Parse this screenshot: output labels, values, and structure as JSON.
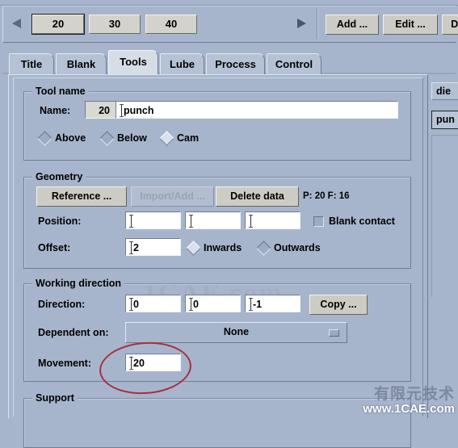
{
  "window": {
    "background_color": "#a7b5cc"
  },
  "toolbar": {
    "prev_arrow_icon": "triangle-left-icon",
    "next_arrow_icon": "triangle-right-icon",
    "pages": [
      {
        "label": "20",
        "selected": true
      },
      {
        "label": "30",
        "selected": false
      },
      {
        "label": "40",
        "selected": false
      }
    ],
    "commands": [
      {
        "label": "Add ..."
      },
      {
        "label": "Edit ..."
      },
      {
        "label": "Del"
      }
    ]
  },
  "tabs": [
    {
      "label": "Title",
      "active": false
    },
    {
      "label": "Blank",
      "active": false
    },
    {
      "label": "Tools",
      "active": true
    },
    {
      "label": "Lube",
      "active": false
    },
    {
      "label": "Process",
      "active": false
    },
    {
      "label": "Control",
      "active": false
    }
  ],
  "tool_name": {
    "group_title": "Tool name",
    "name_label": "Name:",
    "name_prefix": "20",
    "name_value": "punch",
    "placement_options": [
      {
        "label": "Above",
        "selected": false
      },
      {
        "label": "Below",
        "selected": false
      },
      {
        "label": "Cam",
        "selected": true
      }
    ]
  },
  "geometry": {
    "group_title": "Geometry",
    "reference_button": "Reference ...",
    "import_add_button": "Import/Add ...",
    "delete_data_button": "Delete data",
    "counter": "P: 20  F: 16",
    "position_label": "Position:",
    "position_values": [
      "",
      "",
      ""
    ],
    "blank_contact_label": "Blank contact",
    "blank_contact_checked": false,
    "offset_label": "Offset:",
    "offset_value": "2",
    "direction_options": [
      {
        "label": "Inwards",
        "selected": true
      },
      {
        "label": "Outwards",
        "selected": false
      }
    ]
  },
  "working_direction": {
    "group_title": "Working direction",
    "direction_label": "Direction:",
    "direction_values": [
      "0",
      "0",
      "-1"
    ],
    "copy_button": "Copy ...",
    "dependent_label": "Dependent on:",
    "dependent_value": "None",
    "dependent_arrow_icon": "dropdown-arrow-icon",
    "movement_label": "Movement:",
    "movement_value": "20"
  },
  "support": {
    "group_title": "Support"
  },
  "right_column": {
    "die_label": "die",
    "punch_button": "pun"
  },
  "watermarks": {
    "center": "1CAE.com",
    "corner_cn": "有限元技术",
    "corner_url": "www.1CAE.com"
  },
  "annotation": {
    "shape": "red-ellipse-highlight",
    "color": "#a6303c"
  }
}
